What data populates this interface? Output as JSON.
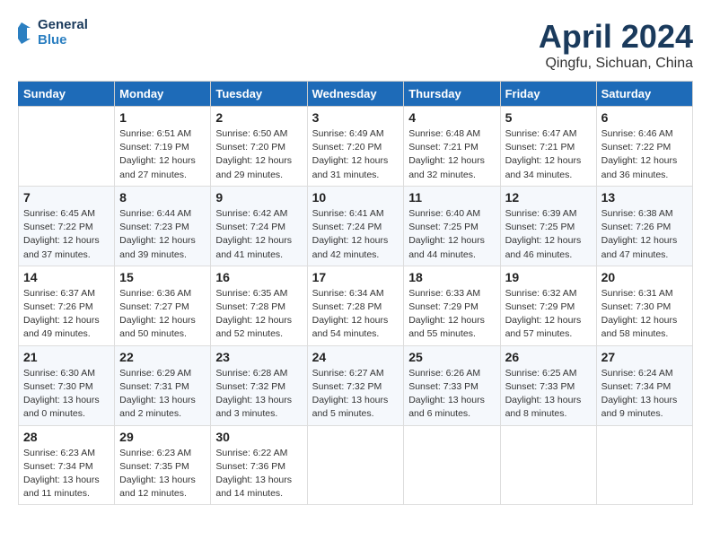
{
  "header": {
    "logo_line1": "General",
    "logo_line2": "Blue",
    "month_title": "April 2024",
    "location": "Qingfu, Sichuan, China"
  },
  "weekdays": [
    "Sunday",
    "Monday",
    "Tuesday",
    "Wednesday",
    "Thursday",
    "Friday",
    "Saturday"
  ],
  "weeks": [
    [
      {
        "day": "",
        "sunrise": "",
        "sunset": "",
        "daylight": ""
      },
      {
        "day": "1",
        "sunrise": "Sunrise: 6:51 AM",
        "sunset": "Sunset: 7:19 PM",
        "daylight": "Daylight: 12 hours and 27 minutes."
      },
      {
        "day": "2",
        "sunrise": "Sunrise: 6:50 AM",
        "sunset": "Sunset: 7:20 PM",
        "daylight": "Daylight: 12 hours and 29 minutes."
      },
      {
        "day": "3",
        "sunrise": "Sunrise: 6:49 AM",
        "sunset": "Sunset: 7:20 PM",
        "daylight": "Daylight: 12 hours and 31 minutes."
      },
      {
        "day": "4",
        "sunrise": "Sunrise: 6:48 AM",
        "sunset": "Sunset: 7:21 PM",
        "daylight": "Daylight: 12 hours and 32 minutes."
      },
      {
        "day": "5",
        "sunrise": "Sunrise: 6:47 AM",
        "sunset": "Sunset: 7:21 PM",
        "daylight": "Daylight: 12 hours and 34 minutes."
      },
      {
        "day": "6",
        "sunrise": "Sunrise: 6:46 AM",
        "sunset": "Sunset: 7:22 PM",
        "daylight": "Daylight: 12 hours and 36 minutes."
      }
    ],
    [
      {
        "day": "7",
        "sunrise": "Sunrise: 6:45 AM",
        "sunset": "Sunset: 7:22 PM",
        "daylight": "Daylight: 12 hours and 37 minutes."
      },
      {
        "day": "8",
        "sunrise": "Sunrise: 6:44 AM",
        "sunset": "Sunset: 7:23 PM",
        "daylight": "Daylight: 12 hours and 39 minutes."
      },
      {
        "day": "9",
        "sunrise": "Sunrise: 6:42 AM",
        "sunset": "Sunset: 7:24 PM",
        "daylight": "Daylight: 12 hours and 41 minutes."
      },
      {
        "day": "10",
        "sunrise": "Sunrise: 6:41 AM",
        "sunset": "Sunset: 7:24 PM",
        "daylight": "Daylight: 12 hours and 42 minutes."
      },
      {
        "day": "11",
        "sunrise": "Sunrise: 6:40 AM",
        "sunset": "Sunset: 7:25 PM",
        "daylight": "Daylight: 12 hours and 44 minutes."
      },
      {
        "day": "12",
        "sunrise": "Sunrise: 6:39 AM",
        "sunset": "Sunset: 7:25 PM",
        "daylight": "Daylight: 12 hours and 46 minutes."
      },
      {
        "day": "13",
        "sunrise": "Sunrise: 6:38 AM",
        "sunset": "Sunset: 7:26 PM",
        "daylight": "Daylight: 12 hours and 47 minutes."
      }
    ],
    [
      {
        "day": "14",
        "sunrise": "Sunrise: 6:37 AM",
        "sunset": "Sunset: 7:26 PM",
        "daylight": "Daylight: 12 hours and 49 minutes."
      },
      {
        "day": "15",
        "sunrise": "Sunrise: 6:36 AM",
        "sunset": "Sunset: 7:27 PM",
        "daylight": "Daylight: 12 hours and 50 minutes."
      },
      {
        "day": "16",
        "sunrise": "Sunrise: 6:35 AM",
        "sunset": "Sunset: 7:28 PM",
        "daylight": "Daylight: 12 hours and 52 minutes."
      },
      {
        "day": "17",
        "sunrise": "Sunrise: 6:34 AM",
        "sunset": "Sunset: 7:28 PM",
        "daylight": "Daylight: 12 hours and 54 minutes."
      },
      {
        "day": "18",
        "sunrise": "Sunrise: 6:33 AM",
        "sunset": "Sunset: 7:29 PM",
        "daylight": "Daylight: 12 hours and 55 minutes."
      },
      {
        "day": "19",
        "sunrise": "Sunrise: 6:32 AM",
        "sunset": "Sunset: 7:29 PM",
        "daylight": "Daylight: 12 hours and 57 minutes."
      },
      {
        "day": "20",
        "sunrise": "Sunrise: 6:31 AM",
        "sunset": "Sunset: 7:30 PM",
        "daylight": "Daylight: 12 hours and 58 minutes."
      }
    ],
    [
      {
        "day": "21",
        "sunrise": "Sunrise: 6:30 AM",
        "sunset": "Sunset: 7:30 PM",
        "daylight": "Daylight: 13 hours and 0 minutes."
      },
      {
        "day": "22",
        "sunrise": "Sunrise: 6:29 AM",
        "sunset": "Sunset: 7:31 PM",
        "daylight": "Daylight: 13 hours and 2 minutes."
      },
      {
        "day": "23",
        "sunrise": "Sunrise: 6:28 AM",
        "sunset": "Sunset: 7:32 PM",
        "daylight": "Daylight: 13 hours and 3 minutes."
      },
      {
        "day": "24",
        "sunrise": "Sunrise: 6:27 AM",
        "sunset": "Sunset: 7:32 PM",
        "daylight": "Daylight: 13 hours and 5 minutes."
      },
      {
        "day": "25",
        "sunrise": "Sunrise: 6:26 AM",
        "sunset": "Sunset: 7:33 PM",
        "daylight": "Daylight: 13 hours and 6 minutes."
      },
      {
        "day": "26",
        "sunrise": "Sunrise: 6:25 AM",
        "sunset": "Sunset: 7:33 PM",
        "daylight": "Daylight: 13 hours and 8 minutes."
      },
      {
        "day": "27",
        "sunrise": "Sunrise: 6:24 AM",
        "sunset": "Sunset: 7:34 PM",
        "daylight": "Daylight: 13 hours and 9 minutes."
      }
    ],
    [
      {
        "day": "28",
        "sunrise": "Sunrise: 6:23 AM",
        "sunset": "Sunset: 7:34 PM",
        "daylight": "Daylight: 13 hours and 11 minutes."
      },
      {
        "day": "29",
        "sunrise": "Sunrise: 6:23 AM",
        "sunset": "Sunset: 7:35 PM",
        "daylight": "Daylight: 13 hours and 12 minutes."
      },
      {
        "day": "30",
        "sunrise": "Sunrise: 6:22 AM",
        "sunset": "Sunset: 7:36 PM",
        "daylight": "Daylight: 13 hours and 14 minutes."
      },
      {
        "day": "",
        "sunrise": "",
        "sunset": "",
        "daylight": ""
      },
      {
        "day": "",
        "sunrise": "",
        "sunset": "",
        "daylight": ""
      },
      {
        "day": "",
        "sunrise": "",
        "sunset": "",
        "daylight": ""
      },
      {
        "day": "",
        "sunrise": "",
        "sunset": "",
        "daylight": ""
      }
    ]
  ]
}
